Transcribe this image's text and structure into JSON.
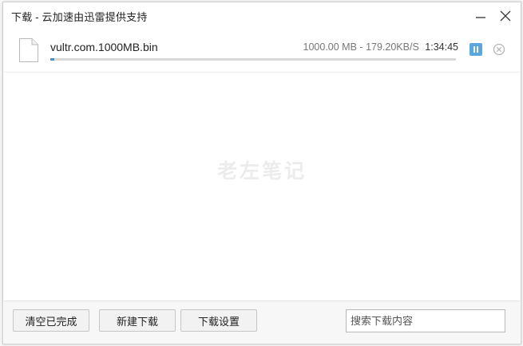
{
  "window": {
    "title": "下载 - 云加速由迅雷提供支持"
  },
  "download": {
    "file_name": "vultr.com.1000MB.bin",
    "size": "1000.00 MB",
    "separator": "-",
    "speed": "179.20KB/S",
    "eta": "1:34:45",
    "progress_fraction": 0.01
  },
  "watermark": "老左笔记",
  "footer": {
    "clear_completed_label": "清空已完成",
    "new_download_label": "新建下载",
    "download_settings_label": "下载设置",
    "search_placeholder": "搜索下载内容"
  },
  "colors": {
    "accent": "#3b95d9",
    "pause_button": "#5aa7e0"
  }
}
